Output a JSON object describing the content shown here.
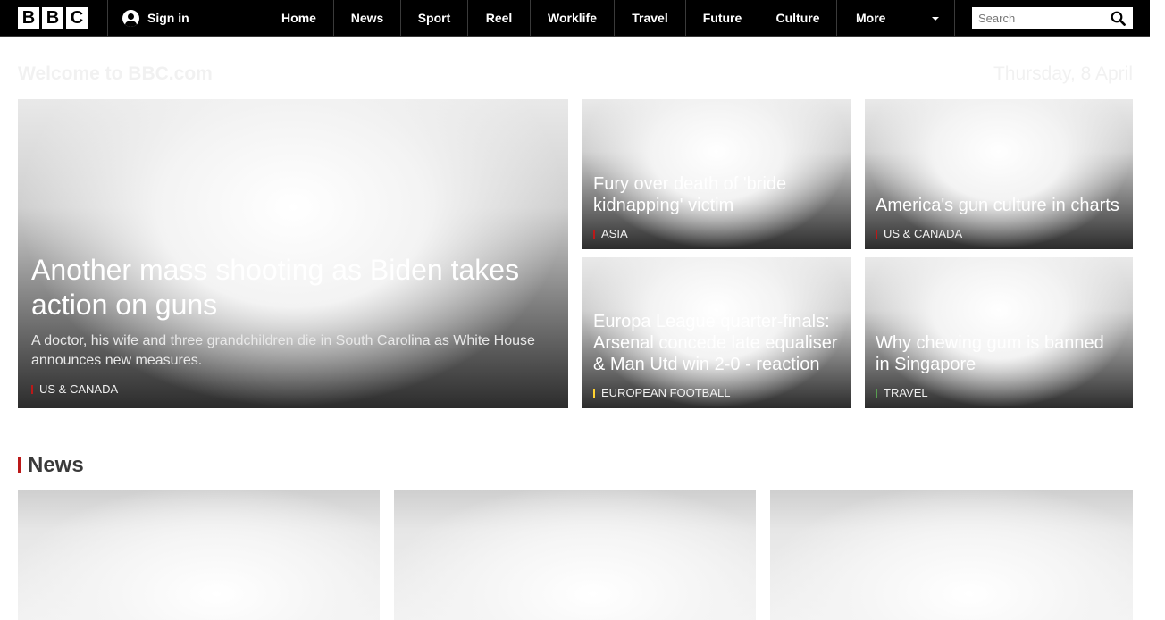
{
  "header": {
    "logo": [
      "B",
      "B",
      "C"
    ],
    "sign_in": "Sign in",
    "nav": [
      "Home",
      "News",
      "Sport",
      "Reel",
      "Worklife",
      "Travel",
      "Future",
      "Culture"
    ],
    "more": "More",
    "search_placeholder": "Search"
  },
  "welcome": {
    "title": "Welcome to BBC.com",
    "date": "Thursday, 8 April"
  },
  "hero": {
    "main": {
      "title": "Another mass shooting as Biden takes action on guns",
      "summary": "A doctor, his wife and three grandchildren die in South Carolina as White House announces new measures.",
      "tag": "US & CANADA",
      "tag_color": "#bb1919"
    },
    "stories": [
      {
        "title": "Fury over death of 'bride kidnapping' victim",
        "tag": "ASIA",
        "tag_color": "#bb1919"
      },
      {
        "title": "America's gun culture in charts",
        "tag": "US & CANADA",
        "tag_color": "#bb1919"
      },
      {
        "title": "Europa League quarter-finals: Arsenal concede late equaliser & Man Utd win 2-0 - reaction",
        "tag": "EUROPEAN FOOTBALL",
        "tag_color": "#ffd230"
      },
      {
        "title": "Why chewing gum is banned in Singapore",
        "tag": "TRAVEL",
        "tag_color": "#589e50"
      }
    ]
  },
  "news_section": {
    "title": "News",
    "accent": "#bb1919"
  }
}
